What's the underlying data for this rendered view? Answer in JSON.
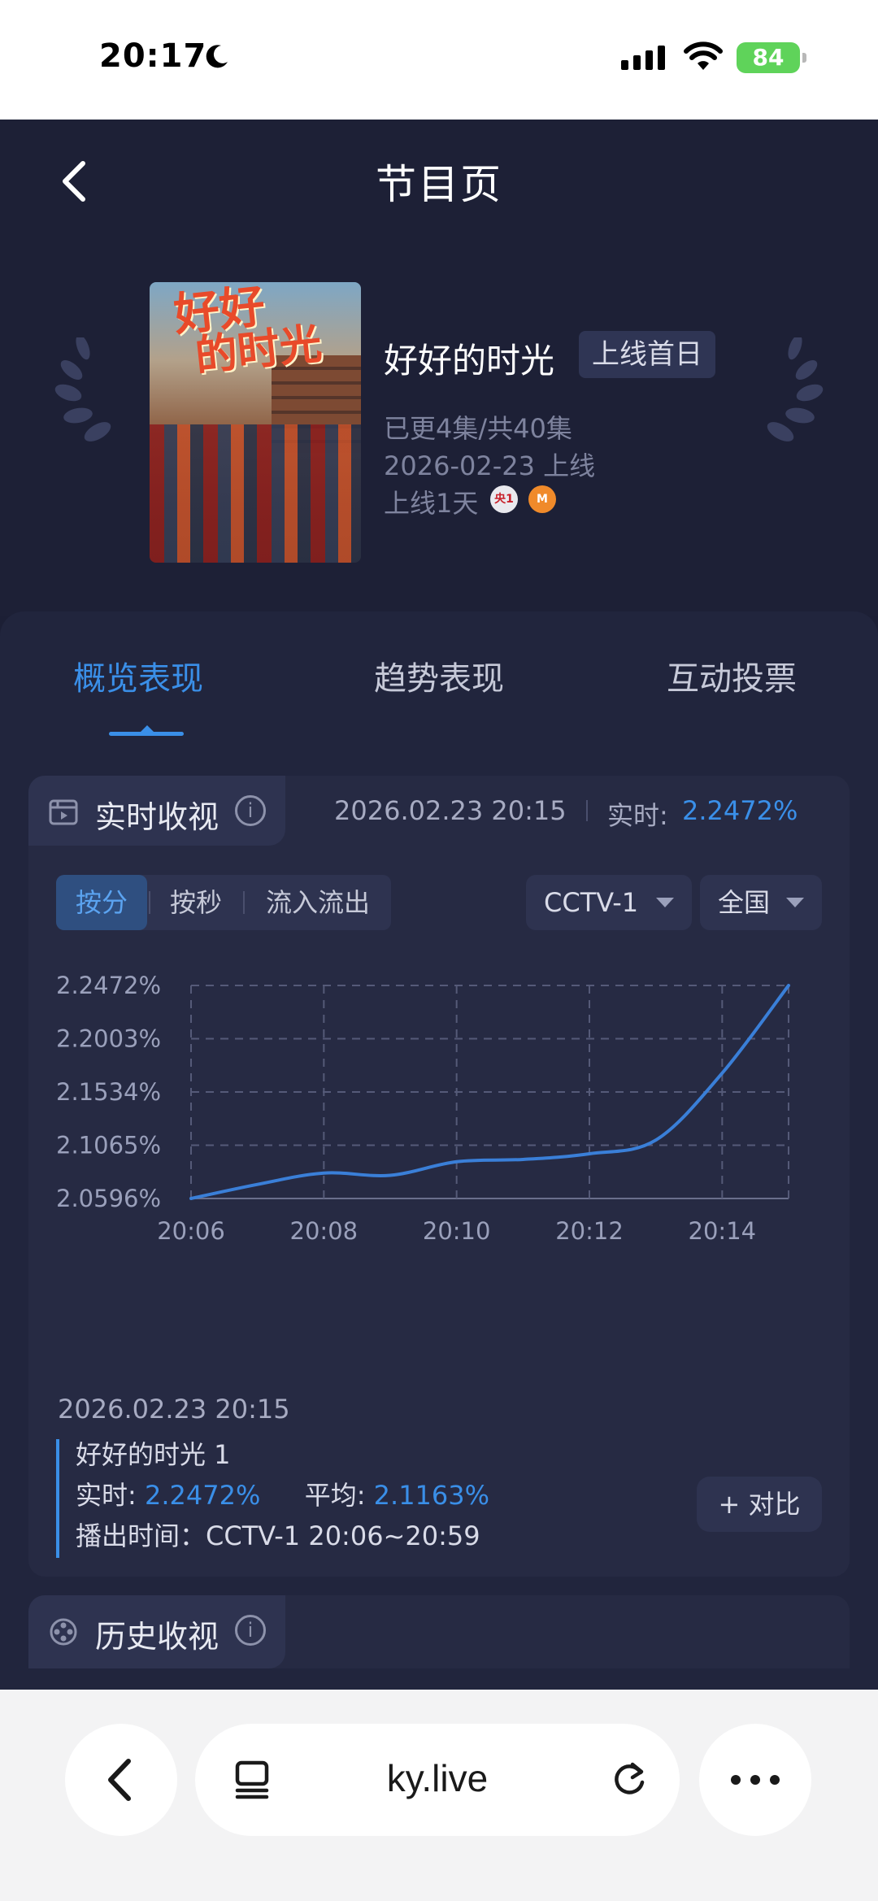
{
  "status_bar": {
    "time": "20:17",
    "battery": "84"
  },
  "header": {
    "title": "节目页"
  },
  "program": {
    "name": "好好的时光",
    "badge": "上线首日",
    "episodes": "已更4集/共40集",
    "release": "2026-02-23 上线",
    "online_days": "上线1天",
    "poster_title_1": "好好",
    "poster_title_2": "的时光",
    "channel_logo_1": "央1",
    "channel_logo_2": "M"
  },
  "tabs": [
    {
      "label": "概览表现",
      "active": true
    },
    {
      "label": "趋势表现",
      "active": false
    },
    {
      "label": "互动投票",
      "active": false
    }
  ],
  "realtime": {
    "section_title": "实时收视",
    "info_icon": "i",
    "timestamp": "2026.02.23 20:15",
    "label": "实时:",
    "value": "2.2472%"
  },
  "segments": [
    {
      "label": "按分",
      "active": true
    },
    {
      "label": "按秒",
      "active": false
    },
    {
      "label": "流入流出",
      "active": false
    }
  ],
  "filters": {
    "channel": "CCTV-1",
    "region": "全国"
  },
  "chart_data": {
    "type": "line",
    "y_ticks": [
      "2.2472%",
      "2.2003%",
      "2.1534%",
      "2.1065%",
      "2.0596%"
    ],
    "x_ticks": [
      "20:06",
      "20:08",
      "20:10",
      "20:12",
      "20:14"
    ],
    "ylim": [
      2.0596,
      2.2472
    ],
    "xlim": [
      "20:06",
      "20:15"
    ],
    "grid": true,
    "series": [
      {
        "color": "#3a7fd8",
        "x": [
          "20:06",
          "20:07",
          "20:08",
          "20:09",
          "20:10",
          "20:11",
          "20:12",
          "20:13",
          "20:14",
          "20:15"
        ],
        "y": [
          2.0596,
          2.072,
          2.082,
          2.08,
          2.092,
          2.094,
          2.099,
          2.111,
          2.17,
          2.2472
        ]
      }
    ]
  },
  "tooltip": {
    "date": "2026.02.23 20:15",
    "name": "好好的时光 1",
    "realtime_label": "实时:",
    "realtime_value": "2.2472%",
    "avg_label": "平均:",
    "avg_value": "2.1163%",
    "air_time": "播出时间：CCTV-1 20:06~20:59",
    "compare_button": "+ 对比"
  },
  "history": {
    "section_title": "历史收视",
    "info_icon": "i"
  },
  "browser": {
    "url": "ky.live"
  },
  "colors": {
    "accent": "#3a8fe8",
    "background": "#1c1f35",
    "card": "#21253d"
  }
}
